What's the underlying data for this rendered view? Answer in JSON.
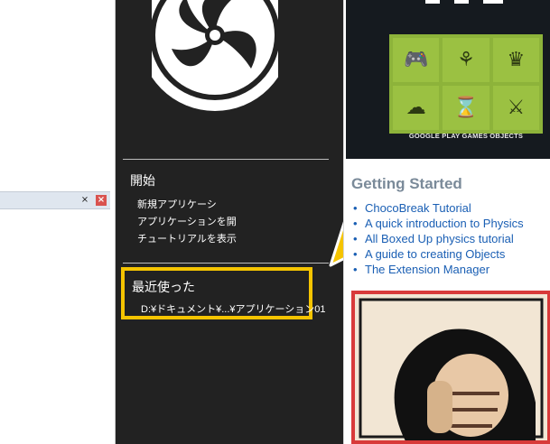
{
  "start": {
    "section_title": "開始",
    "links": [
      "新規アプリケーシ",
      "アプリケーションを開",
      "チュートリアルを表示"
    ],
    "recent_title": "最近使った",
    "recent_item": "D:¥ドキュメント¥...¥アプリケーション01"
  },
  "news": {
    "banner_caption": "GOOGLE PLAY GAMES OBJECTS",
    "getting_started_title": "Getting Started",
    "links": [
      "ChocoBreak Tutorial",
      "A quick introduction to Physics",
      "All Boxed Up physics tutorial",
      "A guide to creating Objects",
      "The Extension Manager"
    ]
  },
  "icons": {
    "pin": "pin-icon",
    "close": "close-icon",
    "tiles": [
      "gamepad-icon",
      "achievement-icon",
      "crown-icon",
      "cloud-upload-icon",
      "hourglass-icon",
      "swords-icon"
    ]
  },
  "colors": {
    "highlight": "#f5c400",
    "dark_panel": "#222222",
    "link": "#1a5fb4",
    "tile_green": "#9bc142"
  }
}
